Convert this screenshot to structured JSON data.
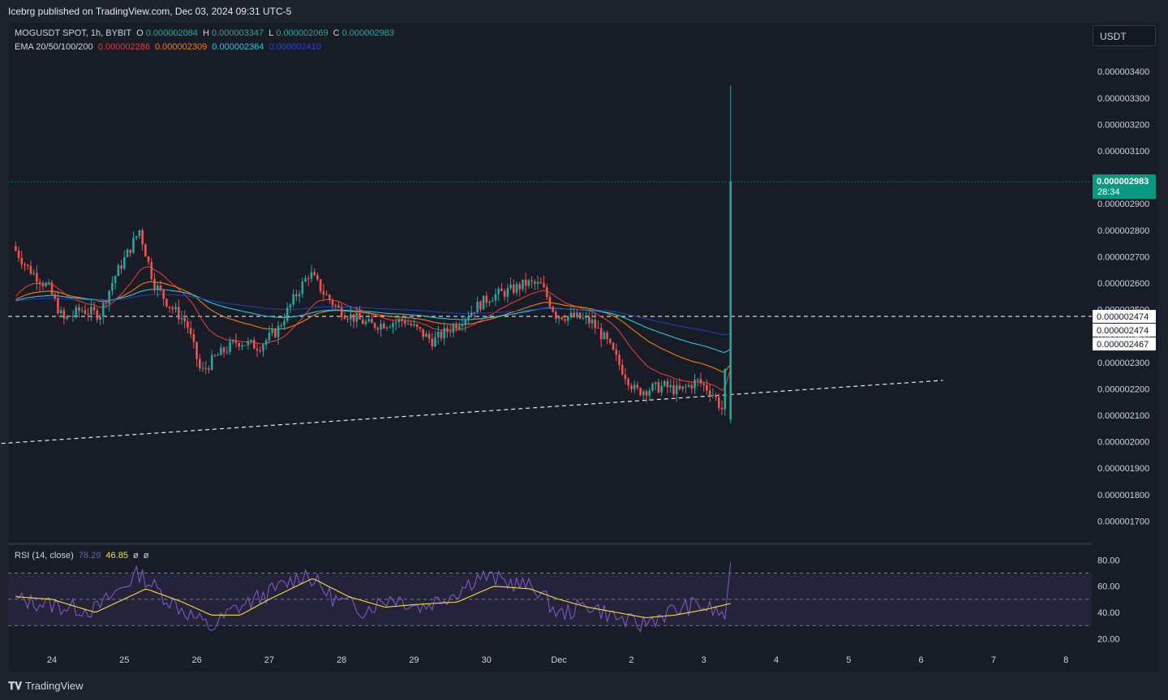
{
  "header": {
    "publisher": "Icebrg published on TradingView.com, Dec 03, 2024 09:31 UTC-5"
  },
  "legend": {
    "symbol": "MOGUSDT SPOT, 1h, BYBIT",
    "o_label": "O",
    "o": "0.000002084",
    "h_label": "H",
    "h": "0.000003347",
    "l_label": "L",
    "l": "0.000002069",
    "c_label": "C",
    "c": "0.000002983",
    "ema_label": "EMA 20/50/100/200",
    "ema20": "0.000002286",
    "ema50": "0.000002309",
    "ema100": "0.000002364",
    "ema200": "0.000002410",
    "rsi_label": "RSI (14, close)",
    "rsi": "78.29",
    "rsi_ma": "46.85",
    "rsi_x1": "ø",
    "rsi_x2": "ø"
  },
  "currency_button": "USDT",
  "price_tag": {
    "price": "0.000002983",
    "countdown": "28:34"
  },
  "hline_labels": [
    "0.000002474",
    "0.000002474",
    "0.000002467"
  ],
  "footer": {
    "brand": "TradingView"
  },
  "colors": {
    "up": "#26a69a",
    "down": "#ef5350",
    "ema20": "#e53935",
    "ema50": "#f57c00",
    "ema100": "#26c6da",
    "ema200": "#1e3fb0",
    "rsi": "#7e57c2",
    "rsi_ma": "#f5e02f"
  },
  "chart_data": [
    {
      "type": "candlestick",
      "title": "MOGUSDT SPOT, 1h, BYBIT",
      "x_ticks": [
        "24",
        "25",
        "26",
        "27",
        "28",
        "29",
        "30",
        "Dec",
        "2",
        "3",
        "4",
        "5",
        "6",
        "7",
        "8"
      ],
      "y_ticks": [
        "0.000003400",
        "0.000003300",
        "0.000003200",
        "0.000003100",
        "0.000003000",
        "0.000002900",
        "0.000002800",
        "0.000002700",
        "0.000002600",
        "0.000002500",
        "0.000002400",
        "0.000002300",
        "0.000002200",
        "0.000002100",
        "0.000002000",
        "0.000001900",
        "0.000001800",
        "0.000001700"
      ],
      "ylim": [
        1.6e-06,
        3.52e-06
      ],
      "unit": "USDT",
      "price_path": [
        [
          23.5,
          2.74
        ],
        [
          23.7,
          2.66
        ],
        [
          24.0,
          2.58
        ],
        [
          24.2,
          2.46
        ],
        [
          24.45,
          2.5
        ],
        [
          24.7,
          2.48
        ],
        [
          24.9,
          2.62
        ],
        [
          25.1,
          2.72
        ],
        [
          25.25,
          2.8
        ],
        [
          25.45,
          2.6
        ],
        [
          25.65,
          2.52
        ],
        [
          25.9,
          2.45
        ],
        [
          26.1,
          2.26
        ],
        [
          26.3,
          2.32
        ],
        [
          26.6,
          2.38
        ],
        [
          26.9,
          2.36
        ],
        [
          27.15,
          2.42
        ],
        [
          27.4,
          2.55
        ],
        [
          27.6,
          2.64
        ],
        [
          27.8,
          2.56
        ],
        [
          28.0,
          2.5
        ],
        [
          28.2,
          2.47
        ],
        [
          28.45,
          2.44
        ],
        [
          28.7,
          2.45
        ],
        [
          28.9,
          2.46
        ],
        [
          29.1,
          2.42
        ],
        [
          29.3,
          2.38
        ],
        [
          29.6,
          2.44
        ],
        [
          29.9,
          2.51
        ],
        [
          30.1,
          2.55
        ],
        [
          30.35,
          2.57
        ],
        [
          30.6,
          2.6
        ],
        [
          30.8,
          2.59
        ],
        [
          31.0,
          2.48
        ],
        [
          31.3,
          2.47
        ],
        [
          31.5,
          2.45
        ],
        [
          31.7,
          2.38
        ],
        [
          31.9,
          2.28
        ],
        [
          32.1,
          2.19
        ],
        [
          32.3,
          2.2
        ],
        [
          32.5,
          2.21
        ],
        [
          32.7,
          2.19
        ],
        [
          32.95,
          2.23
        ],
        [
          33.15,
          2.19
        ],
        [
          33.3,
          2.12
        ],
        [
          33.33,
          2.19
        ],
        [
          33.37,
          2.983
        ]
      ],
      "last_candle": {
        "open": 2.084e-06,
        "high": 3.347e-06,
        "low": 2.069e-06,
        "close": 2.983e-06
      },
      "series": [
        {
          "name": "EMA 20",
          "last": 2.286e-06
        },
        {
          "name": "EMA 50",
          "last": 2.309e-06
        },
        {
          "name": "EMA 100",
          "last": 2.364e-06
        },
        {
          "name": "EMA 200",
          "last": 2.41e-06
        }
      ],
      "horizontal_lines": [
        2.474e-06
      ],
      "trendline": [
        [
          23.0,
          1.988e-06
        ],
        [
          36.3,
          2.232e-06
        ]
      ],
      "grid": false
    },
    {
      "type": "line",
      "title": "RSI (14, close)",
      "y_ticks": [
        "80.00",
        "60.00",
        "40.00",
        "20.00"
      ],
      "ylim": [
        10,
        85
      ],
      "bands": [
        30,
        50,
        70
      ],
      "rsi_path": [
        [
          23.5,
          50
        ],
        [
          24.2,
          44
        ],
        [
          24.6,
          42
        ],
        [
          25.2,
          70
        ],
        [
          25.6,
          50
        ],
        [
          26.0,
          35
        ],
        [
          26.2,
          28
        ],
        [
          26.5,
          42
        ],
        [
          27.0,
          55
        ],
        [
          27.5,
          70
        ],
        [
          27.9,
          50
        ],
        [
          28.3,
          42
        ],
        [
          28.7,
          52
        ],
        [
          29.1,
          44
        ],
        [
          29.6,
          56
        ],
        [
          29.9,
          68
        ],
        [
          30.4,
          62
        ],
        [
          30.7,
          58
        ],
        [
          31.0,
          38
        ],
        [
          31.4,
          46
        ],
        [
          31.8,
          36
        ],
        [
          32.1,
          30
        ],
        [
          32.5,
          40
        ],
        [
          32.9,
          46
        ],
        [
          33.3,
          38
        ],
        [
          33.37,
          78.29
        ]
      ],
      "rsi_ma_path": [
        [
          23.5,
          52
        ],
        [
          24.0,
          50
        ],
        [
          24.6,
          40
        ],
        [
          25.3,
          58
        ],
        [
          25.8,
          48
        ],
        [
          26.2,
          38
        ],
        [
          26.6,
          38
        ],
        [
          27.0,
          50
        ],
        [
          27.6,
          66
        ],
        [
          28.1,
          52
        ],
        [
          28.6,
          44
        ],
        [
          29.0,
          46
        ],
        [
          29.6,
          48
        ],
        [
          30.1,
          60
        ],
        [
          30.6,
          58
        ],
        [
          31.0,
          50
        ],
        [
          31.4,
          44
        ],
        [
          31.8,
          40
        ],
        [
          32.2,
          36
        ],
        [
          32.6,
          38
        ],
        [
          33.0,
          42
        ],
        [
          33.37,
          46.85
        ]
      ],
      "grid": false
    }
  ]
}
